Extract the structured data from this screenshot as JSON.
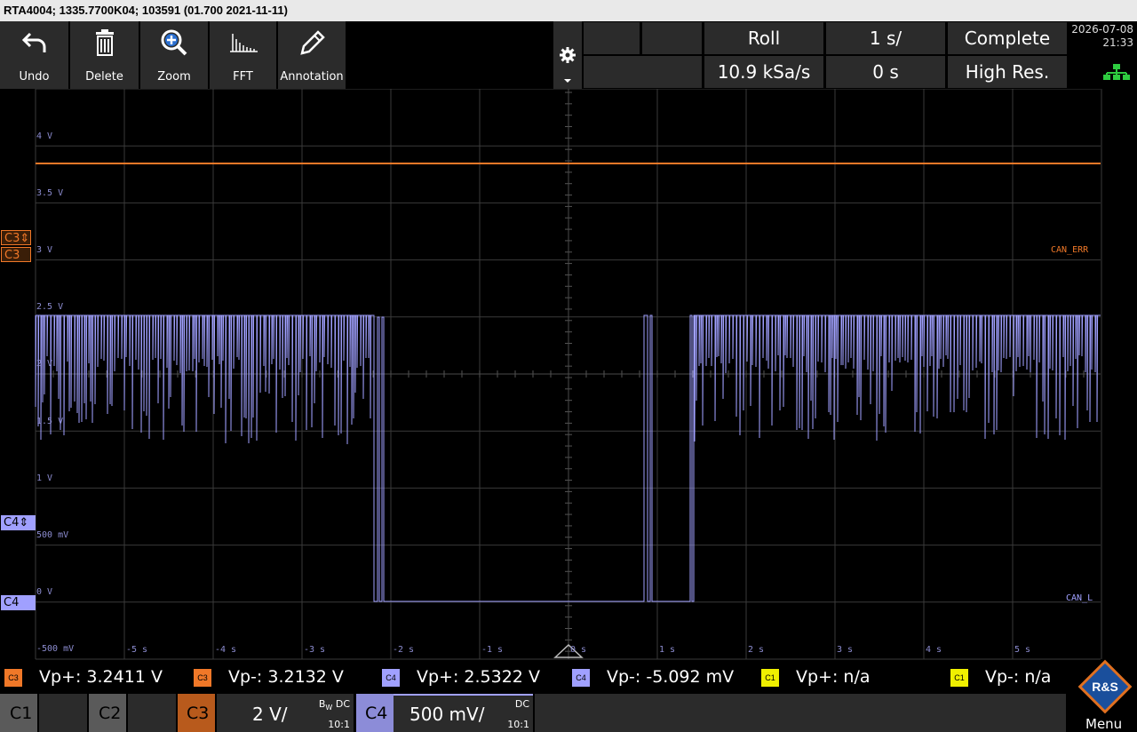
{
  "title": "RTA4004; 1335.7700K04; 103591 (01.700 2021-11-11)",
  "toolbar": {
    "undo": "Undo",
    "delete": "Delete",
    "zoom": "Zoom",
    "fft": "FFT",
    "annotation": "Annotation"
  },
  "acq": {
    "mode": "Roll",
    "timebase": "1 s/",
    "status": "Complete",
    "sample_rate": "10.9 kSa/s",
    "offset": "0 s",
    "resolution": "High Res."
  },
  "datetime": {
    "date": "2026-07-08",
    "time": "21:33"
  },
  "plot": {
    "y_labels": [
      "4 V",
      "3.5 V",
      "3 V",
      "2.5 V",
      "2 V",
      "1.5 V",
      "1 V",
      "500 mV",
      "0 V",
      "-500 mV"
    ],
    "x_labels": [
      "-5 s",
      "-4 s",
      "-3 s",
      "-2 s",
      "-1 s",
      "0 s",
      "1 s",
      "2 s",
      "3 s",
      "4 s",
      "5 s"
    ],
    "trace_labels": {
      "c3": "CAN_ERR",
      "c4": "CAN_L"
    },
    "markers": {
      "c3_trig": "C3",
      "c3": "C3",
      "c4_trig": "C4",
      "c4": "C4"
    },
    "colors": {
      "c3": "#f07828",
      "c4": "#a0a0ff",
      "grid": "#3a3a3a"
    }
  },
  "measurements": [
    {
      "ch": "C3",
      "text": "Vp+: 3.2411 V",
      "color": "#f07828"
    },
    {
      "ch": "C3",
      "text": "Vp-: 3.2132 V",
      "color": "#f07828"
    },
    {
      "ch": "C4",
      "text": "Vp+: 2.5322 V",
      "color": "#a0a0ff"
    },
    {
      "ch": "C4",
      "text": "Vp-: -5.092 mV",
      "color": "#a0a0ff"
    },
    {
      "ch": "C1",
      "text": "Vp+: n/a",
      "color": "#f0f000"
    },
    {
      "ch": "C1",
      "text": "Vp-: n/a",
      "color": "#f0f000"
    }
  ],
  "channels": {
    "c1": "C1",
    "c2": "C2",
    "c3": {
      "name": "C3",
      "scale": "2 V/",
      "bw": "B",
      "bw_sub": "W",
      "coupling": "DC",
      "probe": "10:1"
    },
    "c4": {
      "name": "C4",
      "scale": "500 mV/",
      "coupling": "DC",
      "probe": "10:1"
    },
    "menu": "Menu"
  },
  "logo": "R&S"
}
